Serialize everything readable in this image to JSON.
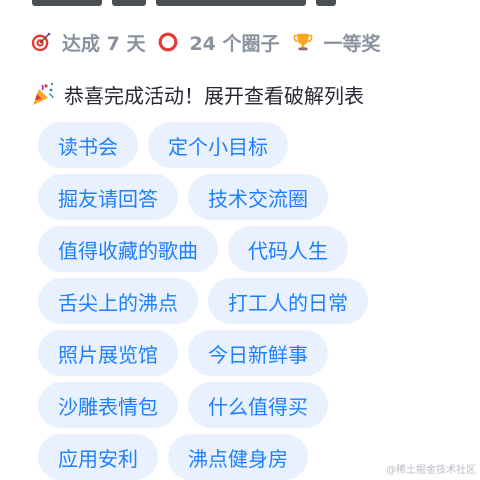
{
  "stats": {
    "days_text": "达成 7 天",
    "circles_text": "24 个圈子",
    "prize_text": "一等奖"
  },
  "congrats": {
    "message": "恭喜完成活动！展开查看破解列表"
  },
  "tags": [
    [
      "读书会",
      "定个小目标"
    ],
    [
      "掘友请回答",
      "技术交流圈"
    ],
    [
      "值得收藏的歌曲",
      "代码人生"
    ],
    [
      "舌尖上的沸点",
      "打工人的日常"
    ],
    [
      "照片展览馆",
      "今日新鲜事"
    ],
    [
      "沙雕表情包",
      "什么值得买"
    ],
    [
      "应用安利",
      "沸点健身房"
    ]
  ],
  "watermark": "@稀土掘金技术社区",
  "colors": {
    "tag_bg": "#e9f1fe",
    "tag_text": "#1e80ff",
    "stat_text": "#8a919f"
  }
}
